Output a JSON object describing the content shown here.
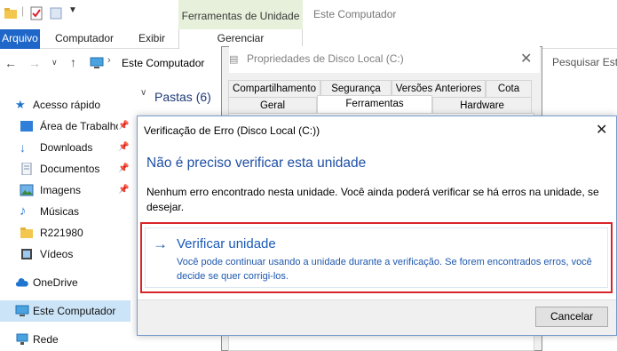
{
  "window": {
    "contextual_tab_group": "Ferramentas de Unidade",
    "title": "Este Computador"
  },
  "ribbon": {
    "tabs": [
      "Arquivo",
      "Computador",
      "Exibir",
      "Gerenciar"
    ]
  },
  "address": {
    "location": "Este Computador",
    "search_placeholder": "Pesquisar Este Computador"
  },
  "nav": {
    "quick_access": "Acesso rápido",
    "items": [
      {
        "label": "Área de Trabalho",
        "icon": "desktop-folder-icon",
        "pinned": true
      },
      {
        "label": "Downloads",
        "icon": "downloads-icon",
        "pinned": true
      },
      {
        "label": "Documentos",
        "icon": "documents-icon",
        "pinned": true
      },
      {
        "label": "Imagens",
        "icon": "pictures-icon",
        "pinned": true
      },
      {
        "label": "Músicas",
        "icon": "music-icon",
        "pinned": false
      },
      {
        "label": "R221980",
        "icon": "folder-icon",
        "pinned": false
      },
      {
        "label": "Vídeos",
        "icon": "videos-icon",
        "pinned": false
      }
    ],
    "onedrive": "OneDrive",
    "this_pc": "Este Computador",
    "network": "Rede"
  },
  "content": {
    "group_header": "Pastas (6)"
  },
  "properties_dialog": {
    "title": "Propriedades de Disco Local (C:)",
    "tabs_row1": [
      "Compartilhamento",
      "Segurança",
      "Versões Anteriores",
      "Cota"
    ],
    "tabs_row2": [
      "Geral",
      "Ferramentas",
      "Hardware"
    ],
    "active_tab": "Ferramentas"
  },
  "error_check_dialog": {
    "title": "Verificação de Erro (Disco Local (C:))",
    "heading": "Não é preciso verificar esta unidade",
    "message": "Nenhum erro encontrado nesta unidade. Você ainda poderá verificar se há erros na unidade, se desejar.",
    "option_title": "Verificar unidade",
    "option_description": "Você pode continuar usando a unidade durante a verificação. Se forem encontrados erros, você decide se quer corrigi-los.",
    "cancel_label": "Cancelar"
  },
  "colors": {
    "accent": "#1a5ab8",
    "highlight_border": "#d9252a",
    "contextual_tab": "#e7f0da",
    "file_tab": "#1e66c8",
    "selected_nav": "#cce4f7"
  }
}
